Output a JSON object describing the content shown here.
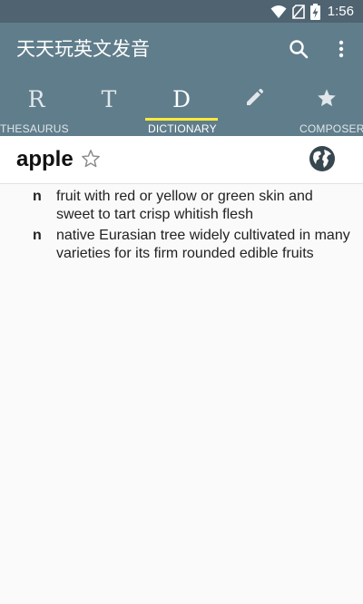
{
  "status_bar": {
    "time": "1:56"
  },
  "app_bar": {
    "title": "天天玩英文发音"
  },
  "tabs": [
    {
      "glyph": "R",
      "label": "THESAURUS"
    },
    {
      "glyph": "T",
      "label": ""
    },
    {
      "glyph": "D",
      "label": "DICTIONARY"
    },
    {
      "glyph": "",
      "label": ""
    },
    {
      "glyph": "",
      "label": "COMPOSER"
    }
  ],
  "entry": {
    "word": "apple",
    "definitions": [
      {
        "pos": "n",
        "text": "fruit with red or yellow or green skin and sweet to tart crisp whitish flesh"
      },
      {
        "pos": "n",
        "text": "native Eurasian tree widely cultivated in many varieties for its firm rounded edible fruits"
      }
    ]
  },
  "colors": {
    "app_bar": "#607d8b",
    "status_bar": "#4f6371",
    "tab_indicator": "#ffeb3b"
  }
}
